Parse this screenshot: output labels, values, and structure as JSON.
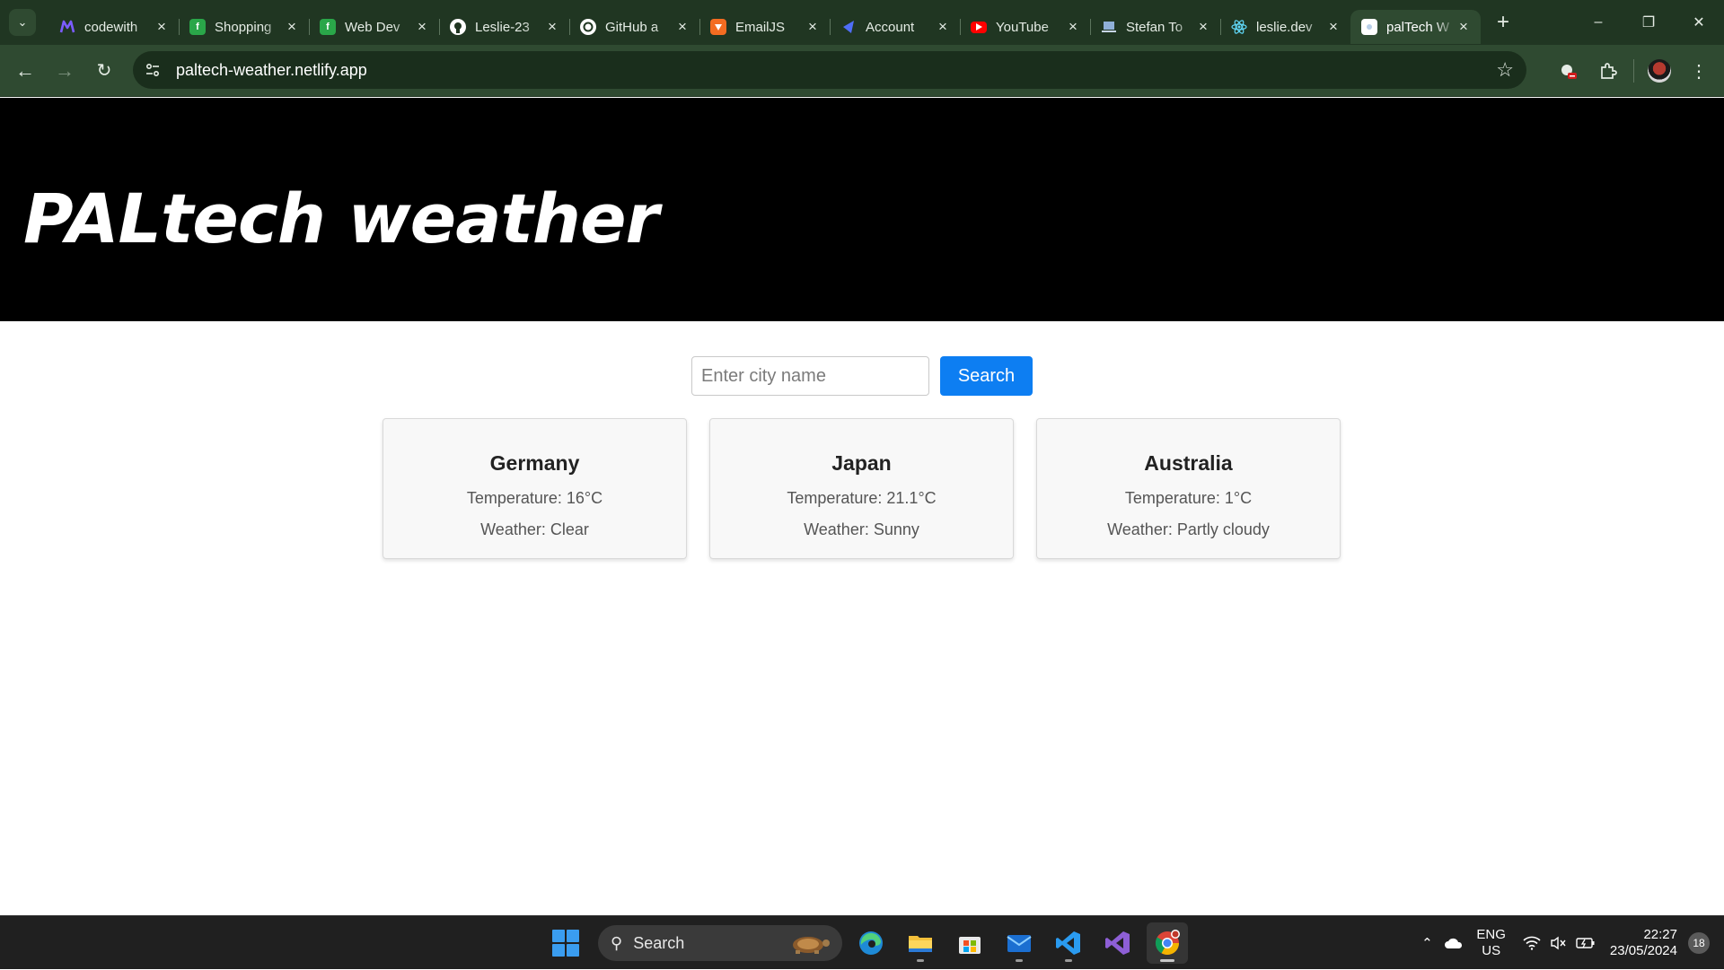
{
  "browser": {
    "tabs": [
      {
        "title": "codewith",
        "favicon": "codewithmosh-icon",
        "color": "#6c3ff5"
      },
      {
        "title": "Shopping",
        "favicon": "freecodecamp-icon",
        "color": "#2aa649"
      },
      {
        "title": "Web Dev",
        "favicon": "freecodecamp-icon",
        "color": "#2aa649"
      },
      {
        "title": "Leslie-23",
        "favicon": "github-icon",
        "color": "#ffffff"
      },
      {
        "title": "GitHub a",
        "favicon": "openai-icon",
        "color": "#ffffff"
      },
      {
        "title": "EmailJS",
        "favicon": "emailjs-icon",
        "color": "#f36c21"
      },
      {
        "title": "Account",
        "favicon": "vercel-account-icon",
        "color": "#4f6ef7"
      },
      {
        "title": "YouTube",
        "favicon": "youtube-icon",
        "color": "#ff0000"
      },
      {
        "title": "Stefan To",
        "favicon": "laptop-icon",
        "color": "#8fb0d8"
      },
      {
        "title": "leslie.dev",
        "favicon": "react-icon",
        "color": "#61dafb"
      },
      {
        "title": "palTech W",
        "favicon": "page-icon",
        "color": "#ffffff",
        "active": true
      }
    ],
    "url": "paltech-weather.netlify.app"
  },
  "page": {
    "title": "PALtech weather",
    "search": {
      "placeholder": "Enter city name",
      "value": "",
      "button_label": "Search"
    },
    "cards": [
      {
        "country": "Germany",
        "temperature": "Temperature: 16°C",
        "weather": "Weather: Clear"
      },
      {
        "country": "Japan",
        "temperature": "Temperature: 21.1°C",
        "weather": "Weather: Sunny"
      },
      {
        "country": "Australia",
        "temperature": "Temperature: 1°C",
        "weather": "Weather: Partly cloudy"
      }
    ]
  },
  "taskbar": {
    "search_label": "Search",
    "apps": [
      "edge-icon",
      "file-explorer-icon",
      "microsoft-store-icon",
      "mail-icon",
      "vscode-icon",
      "visual-studio-icon",
      "chrome-icon"
    ],
    "language": "ENG",
    "region": "US",
    "time": "22:27",
    "date": "23/05/2024",
    "notifications": "18"
  },
  "colors": {
    "chrome_frame": "#203622",
    "chrome_toolbar": "#2f4a31",
    "hero_bg": "#000000",
    "accent_button": "#0d7ef2"
  }
}
